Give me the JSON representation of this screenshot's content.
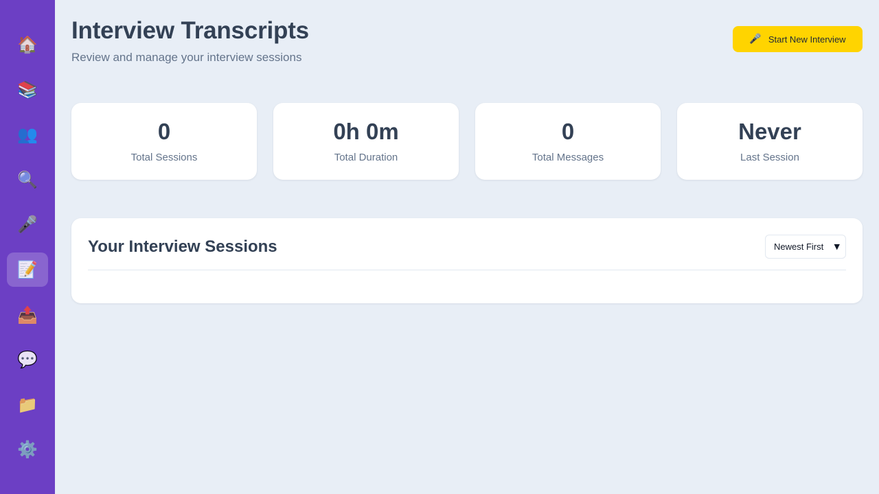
{
  "sidebar": {
    "items": [
      {
        "icon": "🏠"
      },
      {
        "icon": "📚"
      },
      {
        "icon": "👥"
      },
      {
        "icon": "🔍"
      },
      {
        "icon": "🎤"
      },
      {
        "icon": "📝"
      },
      {
        "icon": "📤"
      },
      {
        "icon": "💬"
      },
      {
        "icon": "📁"
      },
      {
        "icon": "⚙️"
      }
    ],
    "accent": "#6c3fc4"
  },
  "header": {
    "title": "Interview Transcripts",
    "subtitle": "Review and manage your interview sessions",
    "start_button": {
      "icon": "🎤",
      "label": "Start New Interview"
    }
  },
  "stats": [
    {
      "value": "0",
      "label": "Total Sessions"
    },
    {
      "value": "0h 0m",
      "label": "Total Duration"
    },
    {
      "value": "0",
      "label": "Total Messages"
    },
    {
      "value": "Never",
      "label": "Last Session"
    }
  ],
  "sessions": {
    "title": "Your Interview Sessions",
    "sort": {
      "selected": "Newest First"
    }
  },
  "colors": {
    "background": "#e8eef6",
    "button": "#ffd400",
    "text": "#334155"
  }
}
